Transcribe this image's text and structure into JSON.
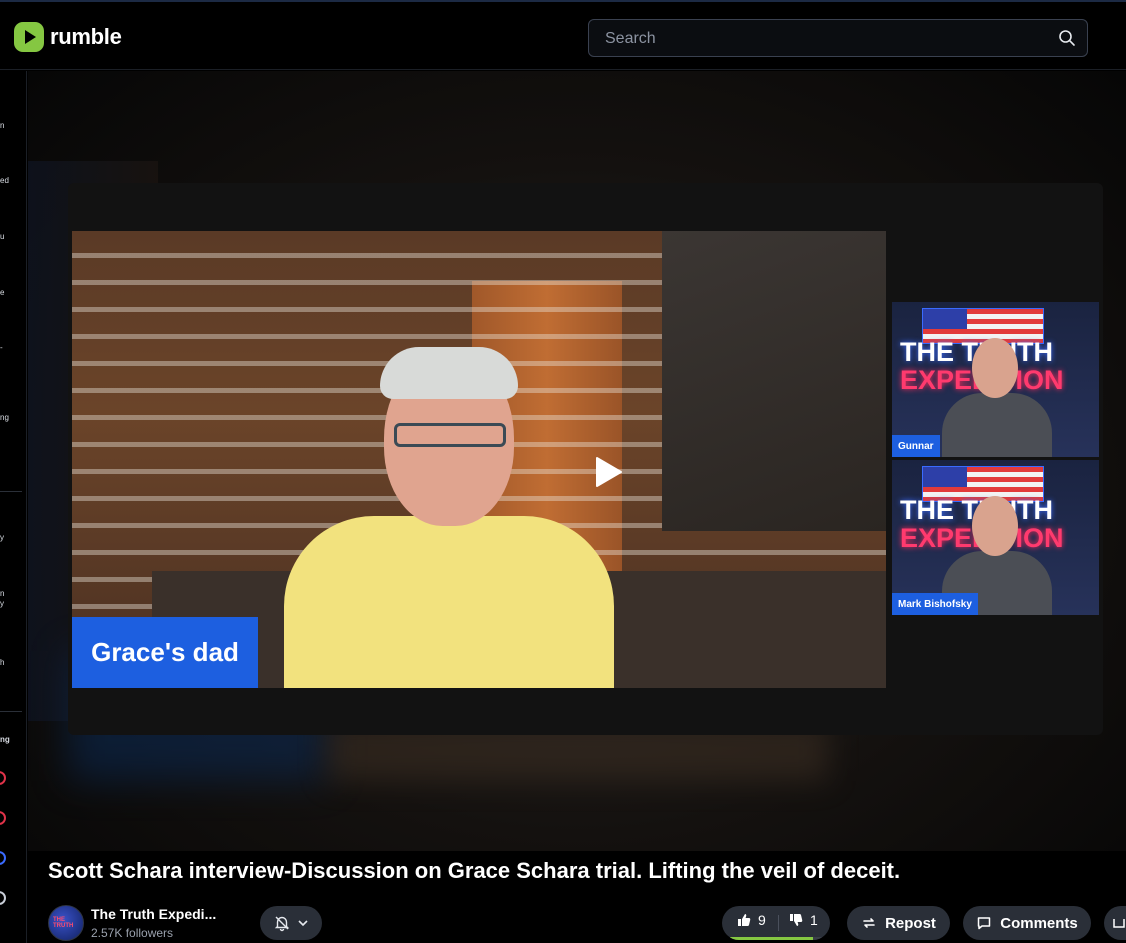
{
  "header": {
    "logo_text": "rumble",
    "search_placeholder": "Search"
  },
  "sidebar": {
    "items": [
      "n",
      "ed",
      "u",
      "e",
      "-",
      "ng",
      "y",
      "n y",
      "h",
      "ng"
    ]
  },
  "player": {
    "main_caption": "Grace's dad",
    "side_videos": [
      {
        "neon_line1": "THE TRUTH",
        "neon_line2": "EXPEDITION",
        "name": "Gunnar"
      },
      {
        "neon_line1": "THE TRUTH",
        "neon_line2": "EXPEDITION",
        "name": "Mark Bishofsky"
      }
    ]
  },
  "video": {
    "title": "Scott Schara interview-Discussion on Grace Schara trial. Lifting the veil of deceit."
  },
  "channel": {
    "name": "The Truth Expedi...",
    "followers": "2.57K followers",
    "avatar_text": "THE TRUTH EXPEDITION"
  },
  "actions": {
    "likes": "9",
    "dislikes": "1",
    "like_ratio": 0.9,
    "repost_label": "Repost",
    "comments_label": "Comments"
  },
  "colors": {
    "brand_green": "#85c742",
    "caption_blue": "#1d5fe0",
    "pill_bg": "#2a2f38"
  }
}
